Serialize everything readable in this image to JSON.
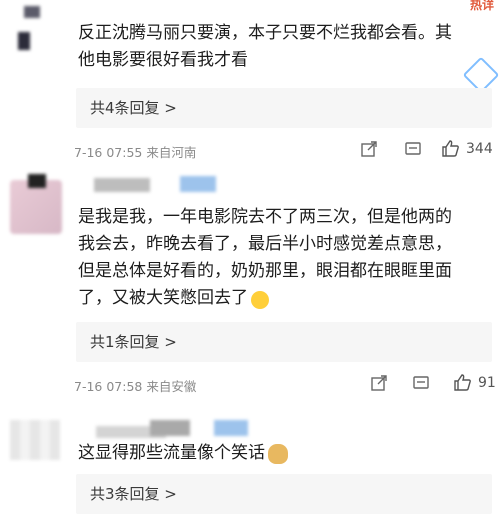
{
  "comments": [
    {
      "text_lines": [
        "反正沈腾马丽只要演，本子只要不烂我都会看。其",
        "他电影要很好看我才看"
      ],
      "reply_summary": "共4条回复 >",
      "meta": "7-16 07:55 来自河南",
      "likes": "344"
    },
    {
      "text_lines": [
        "是我是我，一年电影院去不了两三次，但是他两的",
        "我会去，昨晚去看了，最后半小时感觉差点意思，",
        "但是总体是好看的，奶奶那里，眼泪都在眼眶里面",
        "了，又被大笑憋回去了"
      ],
      "reply_summary": "共1条回复 >",
      "meta": "7-16 07:58 来自安徽",
      "likes": "91"
    },
    {
      "text_lines": [
        "这显得那些流量像个笑话"
      ],
      "reply_summary": "共3条回复 >"
    }
  ],
  "watermark": "热详",
  "colors": {
    "reply_bg": "#f6f6f6",
    "meta": "#8a8a8a",
    "accent": "#e15a3c"
  },
  "icons": [
    "share-icon",
    "comment-icon",
    "like-icon",
    "laugh-cry-emoji",
    "doge-emoji"
  ]
}
